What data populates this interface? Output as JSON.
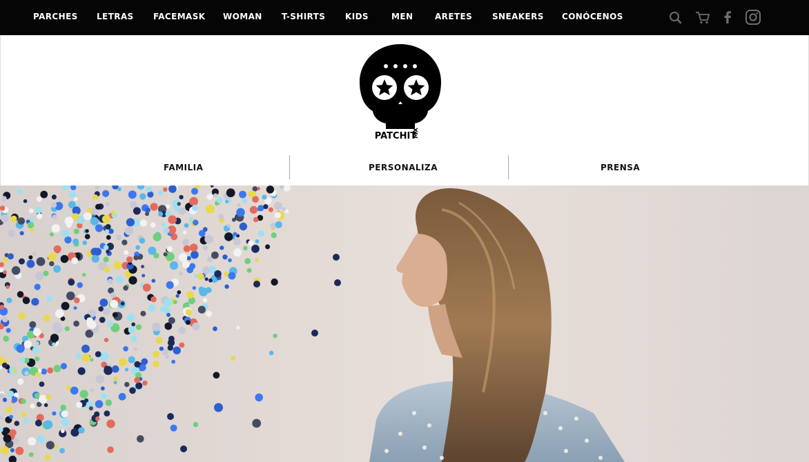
{
  "topnav": {
    "items": [
      "PARCHES",
      "LETRAS",
      "FACEMASK",
      "WOMAN",
      "T-SHIRTS",
      "KIDS",
      "MEN",
      "ARETES",
      "SNEAKERS",
      "CONÓCENOS"
    ]
  },
  "header_icons": [
    "search-icon",
    "cart-icon",
    "facebook-icon",
    "instagram-icon"
  ],
  "logo": {
    "text": "PATCHIT",
    "suffix": "MX"
  },
  "subnav": {
    "items": [
      "FAMILIA",
      "PERSONALIZA",
      "PRENSA"
    ]
  },
  "colors": {
    "topbar": "#050505",
    "header_bg": "#ffffff",
    "hero_bg": "#e6ddd8"
  }
}
